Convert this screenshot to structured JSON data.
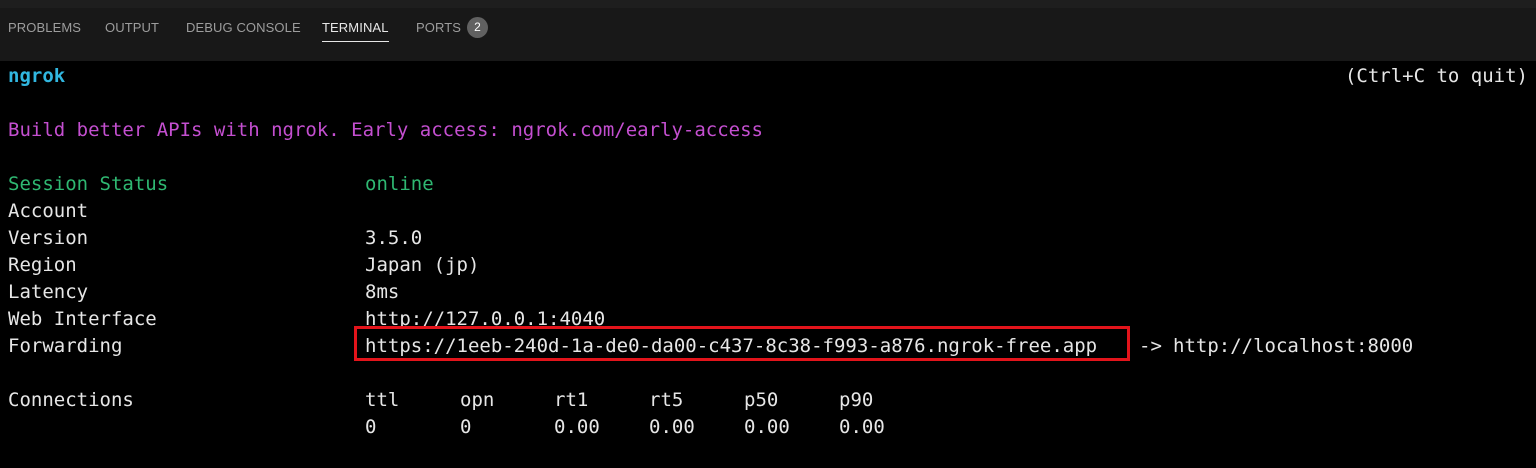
{
  "panel": {
    "tabs": [
      {
        "label": "PROBLEMS"
      },
      {
        "label": "OUTPUT"
      },
      {
        "label": "DEBUG CONSOLE"
      },
      {
        "label": "TERMINAL",
        "active": true
      },
      {
        "label": "PORTS",
        "badge": "2"
      }
    ]
  },
  "terminal": {
    "app_name": "ngrok",
    "quit_hint": "(Ctrl+C to quit)",
    "promo": "Build better APIs with ngrok. Early access: ngrok.com/early-access",
    "session": {
      "status_label": "Session Status",
      "status_value": "online",
      "account_label": "Account",
      "account_value": "",
      "version_label": "Version",
      "version_value": "3.5.0",
      "region_label": "Region",
      "region_value": "Japan (jp)",
      "latency_label": "Latency",
      "latency_value": "8ms",
      "web_interface_label": "Web Interface",
      "web_interface_value": "http://127.0.0.1:4040",
      "forwarding_label": "Forwarding",
      "forwarding_url": "https://1eeb-240d-1a-de0-da00-c437-8c38-f993-a876.ngrok-free.app",
      "forwarding_arrow": "->",
      "forwarding_target": "http://localhost:8000"
    },
    "connections": {
      "label": "Connections",
      "headers": [
        "ttl",
        "opn",
        "rt1",
        "rt5",
        "p50",
        "p90"
      ],
      "values": [
        "0",
        "0",
        "0.00",
        "0.00",
        "0.00",
        "0.00"
      ]
    }
  },
  "colors": {
    "highlight_box": "#e3141b",
    "app_name": "#31b7e0",
    "promo": "#c44fd0",
    "status": "#2fb872"
  }
}
